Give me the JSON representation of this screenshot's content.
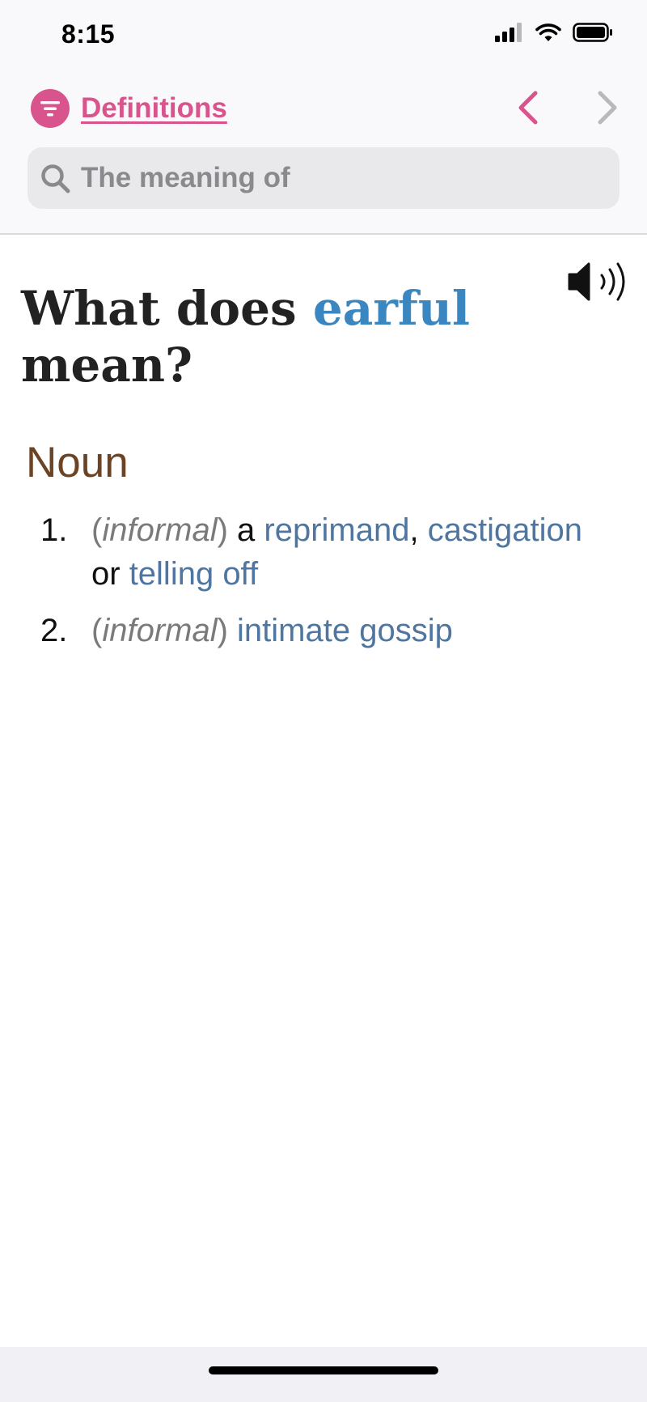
{
  "status_bar": {
    "time": "8:15"
  },
  "nav": {
    "title": "Definitions",
    "menu_icon": "filter-lines-icon",
    "back_icon": "chevron-left-icon",
    "forward_icon": "chevron-right-icon"
  },
  "search": {
    "placeholder": "The meaning of",
    "value": ""
  },
  "entry": {
    "heading_prefix": "What does ",
    "word": "earful",
    "heading_suffix": " mean?",
    "part_of_speech": "Noun",
    "definitions": [
      {
        "number": "1.",
        "open_paren": "(",
        "register": "informal",
        "close_paren": ")",
        "t1": " a ",
        "l1": "reprimand",
        "t2": ", ",
        "l2": "castigation",
        "t3": " or ",
        "l3": "telling off"
      },
      {
        "number": "2.",
        "open_paren": "(",
        "register": "informal",
        "close_paren": ")",
        "t1": " ",
        "l1": "intimate gossip"
      }
    ]
  },
  "colors": {
    "accent": "#d9538c",
    "word": "#3a86c0",
    "link": "#4f76a0",
    "part_of_speech": "#6b4426",
    "search_bg": "#e9e9ec"
  }
}
